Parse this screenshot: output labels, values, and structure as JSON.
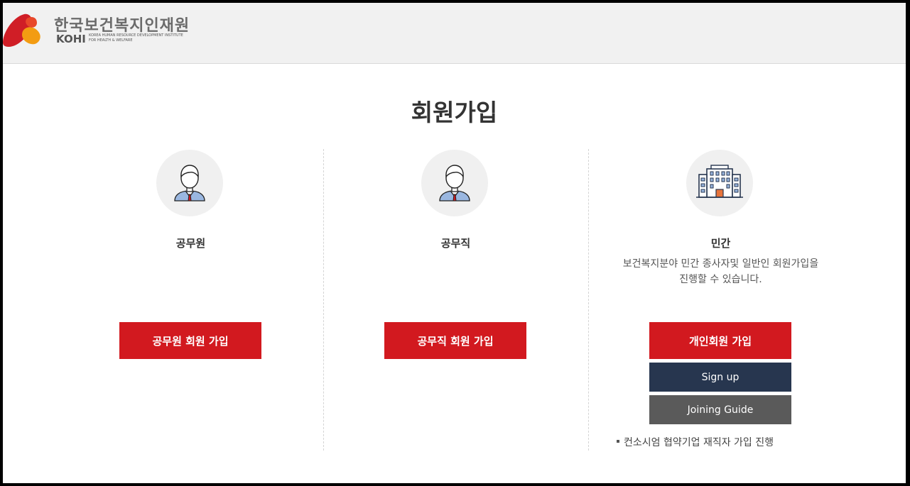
{
  "header": {
    "logo_ko": "한국보건복지인재원",
    "logo_en": "KOHI",
    "logo_sub_line1": "KOREA HUMAN RESOURCE DEVELOPMENT INSTITUTE",
    "logo_sub_line2": "FOR HEALTH & WELFARE"
  },
  "page": {
    "title": "회원가입"
  },
  "columns": [
    {
      "icon": "person-icon",
      "title": "공무원",
      "button": "공무원 회원 가입"
    },
    {
      "icon": "person-icon",
      "title": "공무직",
      "button": "공무직 회원 가입"
    },
    {
      "icon": "building-icon",
      "title": "민간",
      "desc_line1": "보건복지분야 민간 종사자및 일반인 회원가입을",
      "desc_line2": "진행할 수 있습니다.",
      "button": "개인회원 가입",
      "signup": "Sign up",
      "guide": "Joining Guide",
      "note": "컨소시엄 협약기업 재직자 가입 진행"
    }
  ],
  "colors": {
    "primary_red": "#d2191f",
    "navy": "#27364f",
    "gray": "#5a5a5a"
  }
}
